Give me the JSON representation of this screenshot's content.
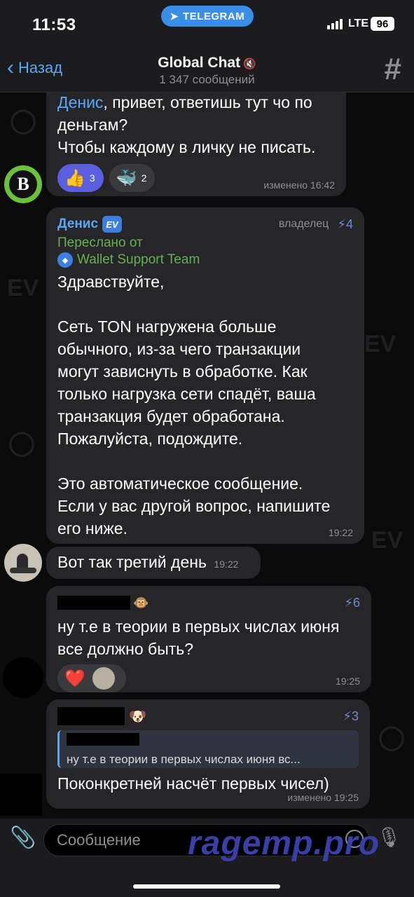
{
  "status": {
    "time": "11:53",
    "pill": "TELEGRAM",
    "network": "LTE",
    "battery": "96"
  },
  "header": {
    "back": "Назад",
    "title": "Global Chat",
    "subtitle": "1 347 сообщений"
  },
  "messages": {
    "m1": {
      "name": "Денис",
      "text_after": ", привет, ответишь тут чо по\nденьгам?\nЧтобы каждому в личку не писать.",
      "reactions": [
        {
          "emoji": "👍",
          "count": "3"
        },
        {
          "emoji": "🐳",
          "count": "2"
        }
      ],
      "meta": "изменено 16:42",
      "avatar_letter": "B"
    },
    "m2": {
      "sender": "Денис",
      "badge": "EV",
      "role": "владелец",
      "boost": "4",
      "forwarded_label": "Переслано от",
      "forwarded_from": "Wallet Support Team",
      "text": "Здравствуйте,\n\nСеть TON нагружена больше\nобычного, из-за чего транзакции\nмогут зависнуть в обработке. Как\nтолько нагрузка сети спадёт, ваша\nтранзакция будет обработана.\nПожалуйста, подождите.\n\nЭто автоматическое сообщение.\nЕсли у вас другой вопрос, напишите\nего ниже.",
      "time": "19:22"
    },
    "m3": {
      "text": "Вот так третий день",
      "time": "19:22"
    },
    "m4": {
      "boost": "6",
      "text": "ну т.е в теории в первых числах июня\nвсе должно быть?",
      "time": "19:25",
      "reaction": "❤️"
    },
    "m5": {
      "boost": "3",
      "reply_text": "ну т.е в теории в первых числах июня вс...",
      "text": "Поконкретней насчёт первых чисел)",
      "meta": "изменено 19:25"
    }
  },
  "input": {
    "placeholder": "Сообщение",
    "watermark": "ragemp.pro"
  }
}
